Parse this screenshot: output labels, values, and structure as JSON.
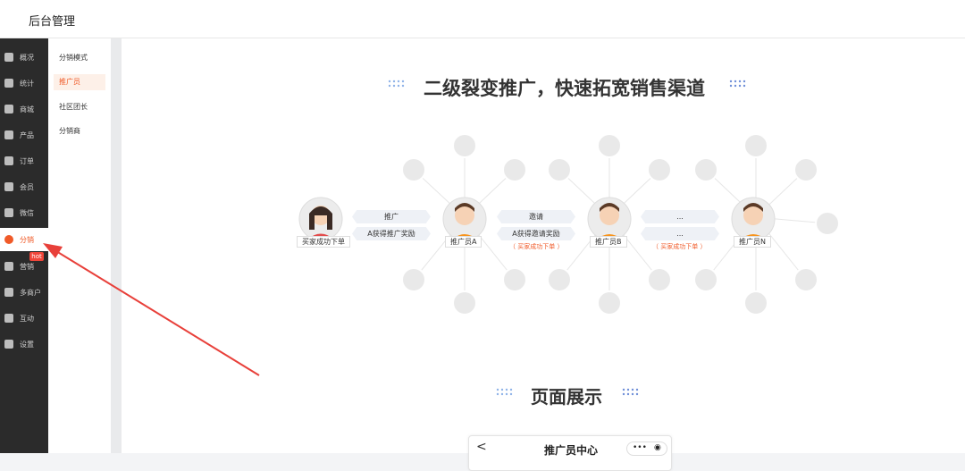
{
  "app": {
    "title": "后台管理"
  },
  "sidebar": {
    "items": [
      {
        "label": "概况",
        "icon": "layers-icon"
      },
      {
        "label": "统计",
        "icon": "chart-icon"
      },
      {
        "label": "商城",
        "icon": "store-icon"
      },
      {
        "label": "产品",
        "icon": "grid-icon"
      },
      {
        "label": "订单",
        "icon": "clipboard-icon"
      },
      {
        "label": "会员",
        "icon": "crown-icon"
      },
      {
        "label": "微信",
        "icon": "wechat-icon"
      },
      {
        "label": "分销",
        "icon": "users-icon",
        "active": true,
        "badge": "hot"
      },
      {
        "label": "营销",
        "icon": "flag-icon"
      },
      {
        "label": "多商户",
        "icon": "shop-icon"
      },
      {
        "label": "互动",
        "icon": "interact-icon"
      },
      {
        "label": "设置",
        "icon": "gear-icon"
      }
    ]
  },
  "subnav": {
    "items": [
      {
        "label": "分销模式"
      },
      {
        "label": "推广员",
        "active": true
      },
      {
        "label": "社区团长"
      },
      {
        "label": "分销商"
      }
    ]
  },
  "main": {
    "heading1": "二级裂变推广，快速拓宽销售渠道",
    "heading2": "页面展示",
    "flow": {
      "buyer_label": "买家成功下单",
      "step1": {
        "top": "推广",
        "bottom": "A获得推广奖励"
      },
      "promoter_a": "推广员A",
      "step2": {
        "top": "邀请",
        "bottom": "A获得邀请奖励",
        "note": "（ 买家成功下单 ）"
      },
      "promoter_b": "推广员B",
      "step3": {
        "top": "...",
        "bottom": "...",
        "note": "（ 买家成功下单 ）"
      },
      "promoter_n": "推广员N"
    },
    "phone": {
      "back": "<",
      "title": "推广员中心",
      "more": "•••",
      "target": "◉"
    }
  },
  "colors": {
    "accent": "#f05a28",
    "sidebar": "#2b2b2b",
    "badge": "#f0463a",
    "arrow": "#e8403a"
  }
}
